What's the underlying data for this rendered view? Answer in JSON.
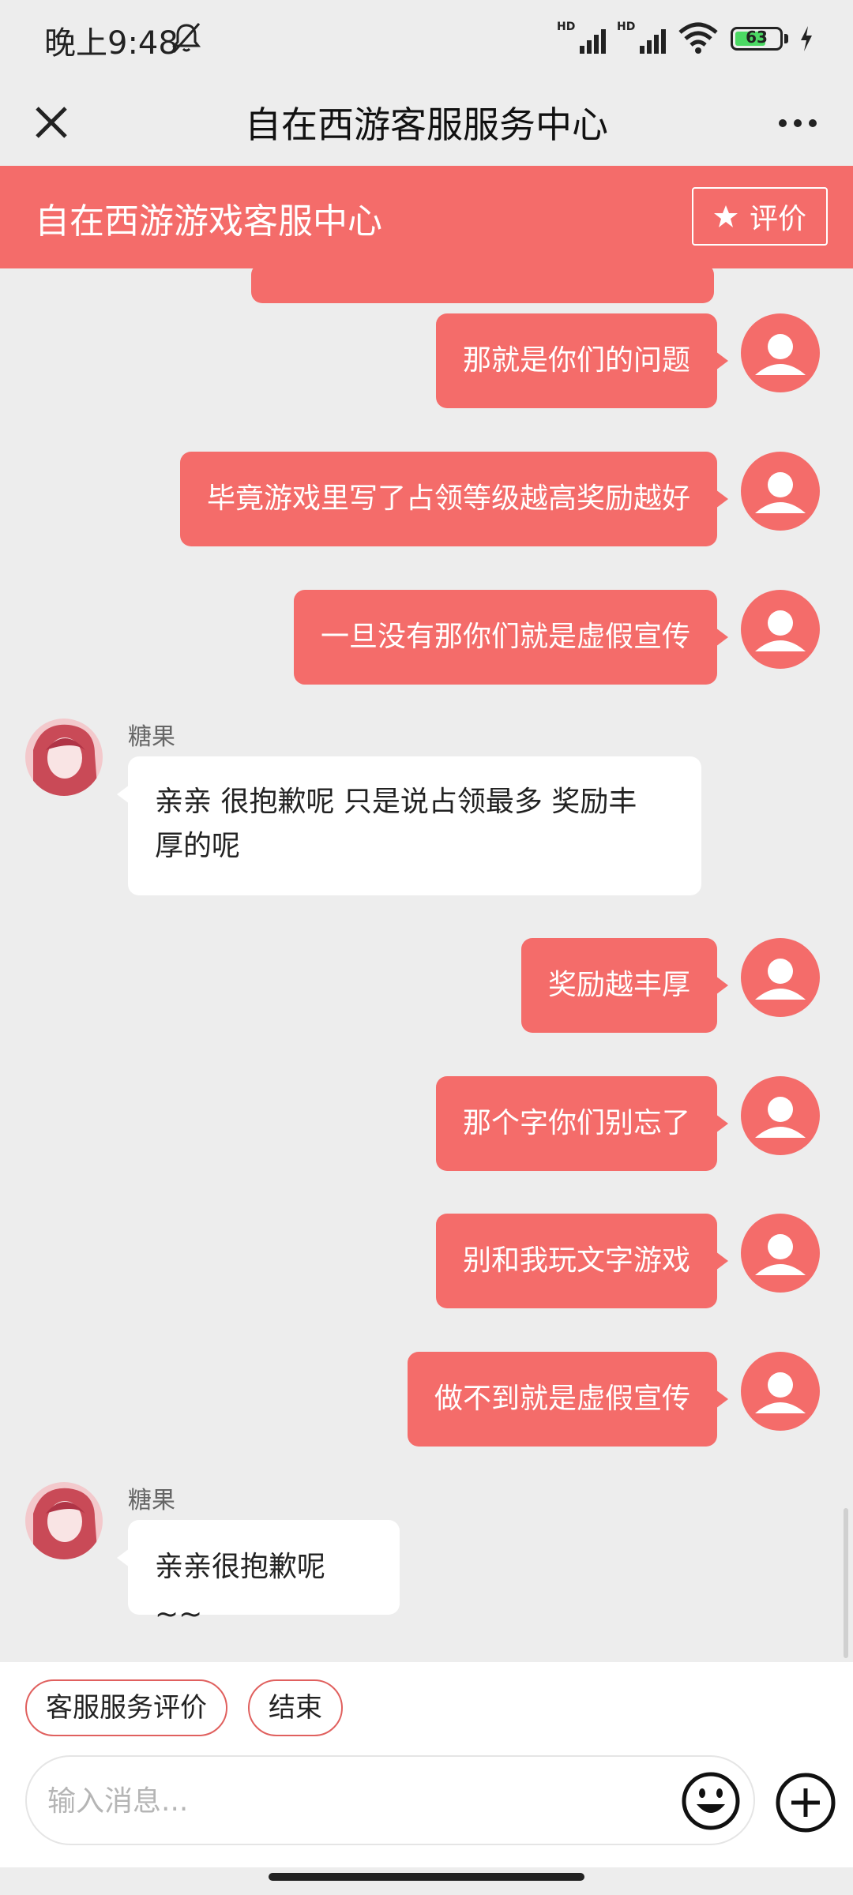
{
  "status_bar": {
    "time": "晚上9:48",
    "signal_label_1": "HD",
    "signal_label_2": "HD",
    "battery": "63"
  },
  "nav": {
    "title": "自在西游客服服务中心"
  },
  "banner": {
    "title": "自在西游游戏客服中心",
    "rate_label": "评价"
  },
  "messages": {
    "out_1": "那就是你们的问题",
    "out_2": "毕竟游戏里写了占领等级越高奖励越好",
    "out_3": "一旦没有那你们就是虚假宣传",
    "agent_1_name": "糖果",
    "in_1_line1": "亲亲 很抱歉呢 只是说占领最多 奖励丰",
    "in_1_line2": "厚的呢",
    "out_4": "奖励越丰厚",
    "out_5": "那个字你们别忘了",
    "out_6": "别和我玩文字游戏",
    "out_7": "做不到就是虚假宣传",
    "agent_2_name": "糖果",
    "in_2": "亲亲很抱歉呢 ~~"
  },
  "quick_actions": {
    "rate_service": "客服服务评价",
    "end": "结束"
  },
  "input": {
    "placeholder": "输入消息..."
  },
  "colors": {
    "accent": "#f46c6a",
    "background": "#ededed",
    "bubble_in": "#ffffff"
  },
  "icons": [
    "close-icon",
    "more-icon",
    "star-icon",
    "user-avatar-icon",
    "emoji-icon",
    "plus-icon",
    "mute-bell-icon",
    "wifi-icon",
    "battery-icon",
    "charging-icon"
  ]
}
